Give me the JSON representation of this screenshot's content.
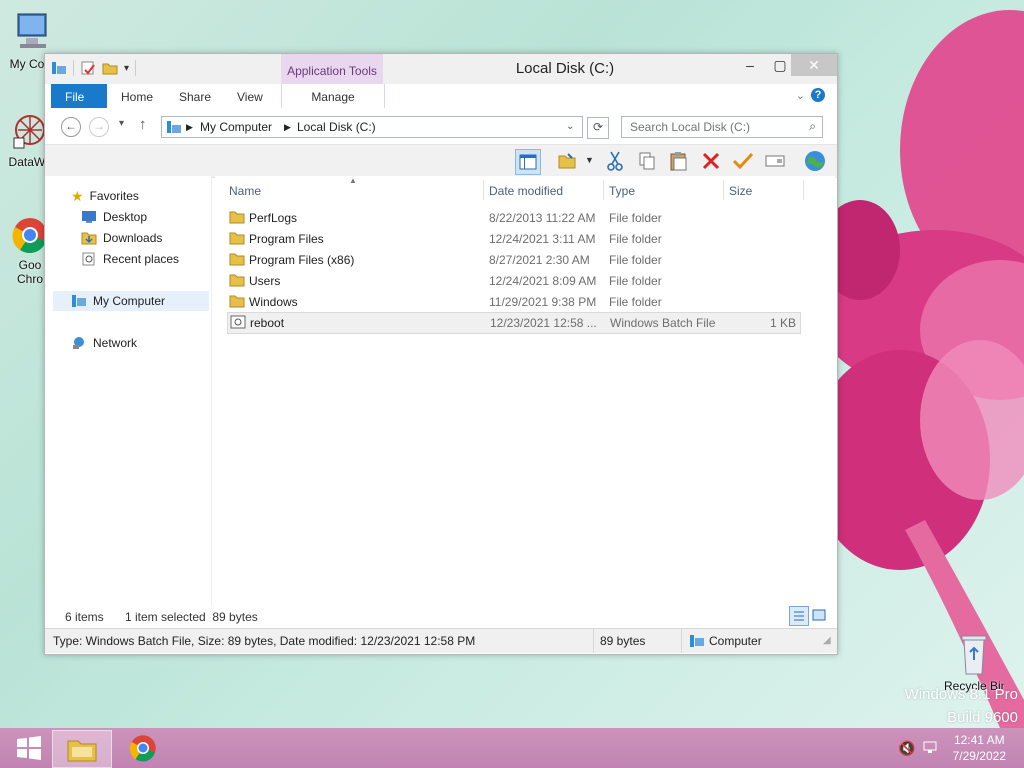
{
  "desktop": {
    "icons": [
      {
        "label": "My Com",
        "icon": "monitor-icon"
      },
      {
        "label": "DataWa",
        "icon": "app-shortcut-icon"
      },
      {
        "label": "Goo",
        "label2": "Chro",
        "icon": "chrome-icon"
      }
    ],
    "recycle_bin": "Recycle Bin",
    "watermark_line1": "Windows 8.1 Pro",
    "watermark_line2": "Build 9600"
  },
  "window": {
    "title": "Local Disk (C:)",
    "contextual_group": "Application Tools",
    "ribbon_tabs": [
      "File",
      "Home",
      "Share",
      "View",
      "Manage"
    ],
    "breadcrumb": [
      "My Computer",
      "Local Disk (C:)"
    ],
    "search_placeholder": "Search Local Disk (C:)",
    "nav": {
      "favorites": "Favorites",
      "favorites_items": [
        "Desktop",
        "Downloads",
        "Recent places"
      ],
      "computer": "My Computer",
      "network": "Network"
    },
    "columns": [
      "Name",
      "Date modified",
      "Type",
      "Size"
    ],
    "files": {
      "rows": [
        {
          "name": "PerfLogs",
          "date": "8/22/2013 11:22 AM",
          "type": "File folder",
          "size": ""
        },
        {
          "name": "Program Files",
          "date": "12/24/2021 3:11 AM",
          "type": "File folder",
          "size": ""
        },
        {
          "name": "Program Files (x86)",
          "date": "8/27/2021 2:30 AM",
          "type": "File folder",
          "size": ""
        },
        {
          "name": "Users",
          "date": "12/24/2021 8:09 AM",
          "type": "File folder",
          "size": ""
        },
        {
          "name": "Windows",
          "date": "11/29/2021 9:38 PM",
          "type": "File folder",
          "size": ""
        },
        {
          "name": "reboot",
          "date": "12/23/2021 12:58 ...",
          "type": "Windows Batch File",
          "size": "1 KB"
        }
      ]
    },
    "status_left": {
      "count": "6 items",
      "selected": "1 item selected  89 bytes"
    },
    "status_bar": {
      "details": "Type: Windows Batch File, Size: 89 bytes, Date modified: 12/23/2021 12:58 PM",
      "size": "89 bytes",
      "location": "Computer"
    }
  },
  "taskbar": {
    "time": "12:41 AM",
    "date": "7/29/2022"
  },
  "colors": {
    "accent": "#1979ca",
    "contextual": "#e9d6ef",
    "taskbar": "#c98ab8"
  }
}
